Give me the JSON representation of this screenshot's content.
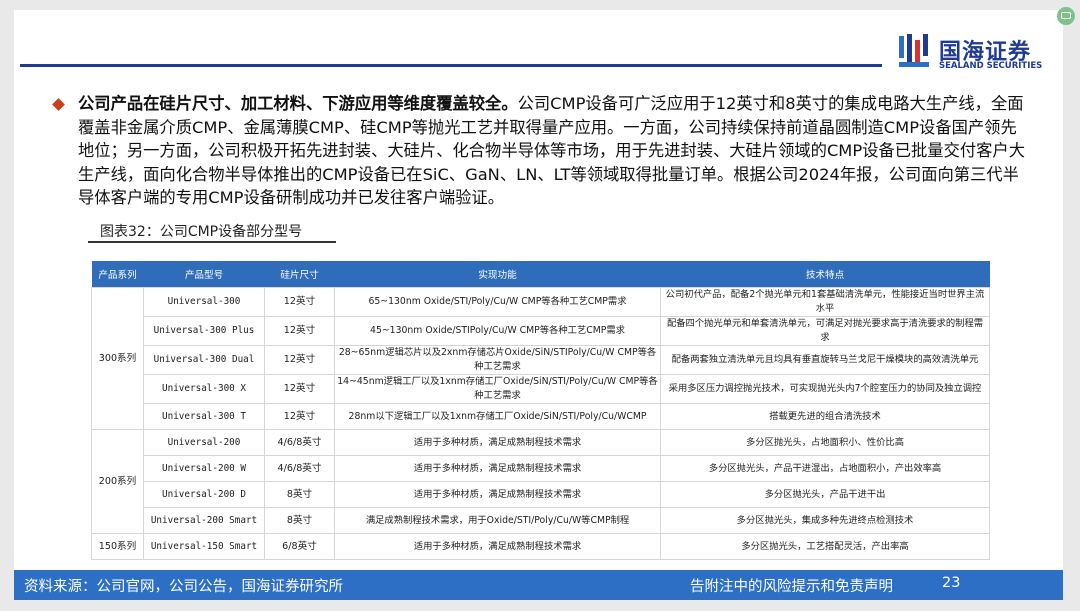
{
  "logo": {
    "name_cn": "国海证券",
    "name_en": "SEALAND SECURITIES"
  },
  "paragraph": {
    "bold": "公司产品在硅片尺寸、加工材料、下游应用等维度覆盖较全。",
    "text": "公司CMP设备可广泛应用于12英寸和8英寸的集成电路大生产线，全面覆盖非金属介质CMP、金属薄膜CMP、硅CMP等抛光工艺并取得量产应用。一方面，公司持续保持前道晶圆制造CMP设备国产领先地位；另一方面，公司积极开拓先进封装、大硅片、化合物半导体等市场，用于先进封装、大硅片领域的CMP设备已批量交付客户大生产线，面向化合物半导体推出的CMP设备已在SiC、GaN、LN、LT等领域取得批量订单。根据公司2024年报，公司面向第三代半导体客户端的专用CMP设备研制成功并已发往客户端验证。"
  },
  "figure_title": "图表32：公司CMP设备部分型号",
  "table": {
    "headers": [
      "产品系列",
      "产品型号",
      "硅片尺寸",
      "实现功能",
      "技术特点"
    ],
    "groups": [
      {
        "series": "300系列",
        "rows": [
          {
            "model": "Universal-300",
            "size": "12英寸",
            "function": "65~130nm Oxide/STI/Poly/Cu/W CMP等各种工艺CMP需求",
            "feature": "公司初代产品，配备2个抛光单元和1套基础清洗单元，性能接近当时世界主流水平"
          },
          {
            "model": "Universal-300 Plus",
            "size": "12英寸",
            "function": "45~130nm Oxide/STIPoly/Cu/W CMP等各种工艺CMP需求",
            "feature": "配备四个抛光单元和单套清洗单元，可满足对抛光要求高于清洗要求的制程需求"
          },
          {
            "model": "Universal-300 Dual",
            "size": "12英寸",
            "function": "28~65nm逻辑芯片以及2xnm存储芯片Oxide/SiN/STIPoly/Cu/W CMP等各种工艺需求",
            "feature": "配备两套独立清洗单元且均具有垂直旋转马兰戈尼干燥模块的高效清洗单元"
          },
          {
            "model": "Universal-300 X",
            "size": "12英寸",
            "function": "14~45nm逻辑工厂以及1xnm存储工厂Oxide/SiN/STI/Poly/Cu/W CMP等各种工艺需求",
            "feature": "采用多区压力调控抛光技术，可实现抛光头内7个腔室压力的协同及独立调控"
          },
          {
            "model": "Universal-300 T",
            "size": "12英寸",
            "function": "28nm以下逻辑工厂以及1xnm存储工厂Oxide/SiN/STI/Poly/Cu/WCMP",
            "feature": "搭载更先进的组合清洗技术"
          }
        ]
      },
      {
        "series": "200系列",
        "rows": [
          {
            "model": "Universal-200",
            "size": "4/6/8英寸",
            "function": "适用于多种材质，满足成熟制程技术需求",
            "feature": "多分区抛光头，占地面积小、性价比高"
          },
          {
            "model": "Universal-200 W",
            "size": "4/6/8英寸",
            "function": "适用于多种材质，满足成熟制程技术需求",
            "feature": "多分区抛光头，产品干进湿出，占地面积小，产出效率高"
          },
          {
            "model": "Universal-200 D",
            "size": "8英寸",
            "function": "适用于多种材质，满足成熟制程技术需求",
            "feature": "多分区抛光头，产品干进干出"
          },
          {
            "model": "Universal-200 Smart",
            "size": "8英寸",
            "function": "满足成熟制程技术需求，用于Oxide/STI/Poly/Cu/W等CMP制程",
            "feature": "多分区抛光头，集成多种先进终点检测技术"
          }
        ]
      },
      {
        "series": "150系列",
        "rows": [
          {
            "model": "Universal-150 Smart",
            "size": "6/8英寸",
            "function": "适用于多种材质，满足成熟制程技术需求",
            "feature": "多分区抛光头，工艺搭配灵活，产出率高"
          }
        ]
      }
    ]
  },
  "footer": {
    "source": "资料来源：公司官网，公司公告，国海证券研究所",
    "disclaimer": "告附注中的风险提示和免责声明",
    "page": "23"
  },
  "colors": {
    "brand_blue": "#1f3a93",
    "header_blue": "#2f6dbb",
    "footer_blue": "#2c6fc4",
    "bullet_red": "#c9411b"
  }
}
